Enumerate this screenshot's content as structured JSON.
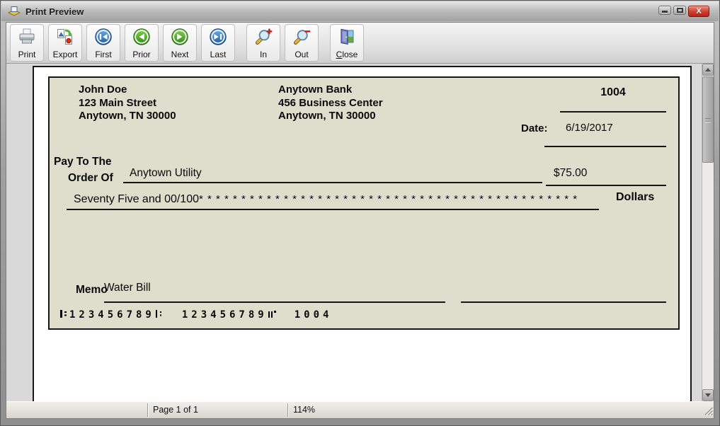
{
  "window": {
    "title": "Print Preview",
    "close_glyph": "X"
  },
  "toolbar": {
    "buttons": [
      {
        "label": "Print",
        "icon": "printer-icon"
      },
      {
        "label": "Export",
        "icon": "export-icon"
      },
      {
        "label": "First",
        "icon": "first-page-icon"
      },
      {
        "label": "Prior",
        "icon": "prior-page-icon"
      },
      {
        "label": "Next",
        "icon": "next-page-icon"
      },
      {
        "label": "Last",
        "icon": "last-page-icon"
      },
      {
        "label": "In",
        "icon": "zoom-in-icon"
      },
      {
        "label": "Out",
        "icon": "zoom-out-icon"
      },
      {
        "label_accel": "C",
        "label_rest": "lose",
        "icon": "close-door-icon"
      }
    ]
  },
  "check": {
    "payer": {
      "name": "John Doe",
      "address1": "123 Main Street",
      "address2": "Anytown, TN 30000"
    },
    "bank": {
      "name": "Anytown Bank",
      "address1": "456 Business Center",
      "address2": "Anytown, TN 30000"
    },
    "number": "1004",
    "date_label": "Date:",
    "date": "6/19/2017",
    "pay_label_line1": "Pay To The",
    "pay_label_line2": "Order Of",
    "payee": "Anytown Utility",
    "amount": "$75.00",
    "amount_words": "Seventy Five  and 00/100",
    "amount_words_fill": "* * * * * * * * * * * * * * * * * * * * * * * * * * * * * * * * * * * * * * * * * * * * *",
    "dollars_label": "Dollars",
    "memo_label": "Memo",
    "memo": "Water Bill",
    "micr": {
      "routing": "123456789",
      "account": "123456789",
      "check_number": "1004"
    }
  },
  "statusbar": {
    "page_info": "Page 1 of 1",
    "zoom_level": "114%"
  }
}
